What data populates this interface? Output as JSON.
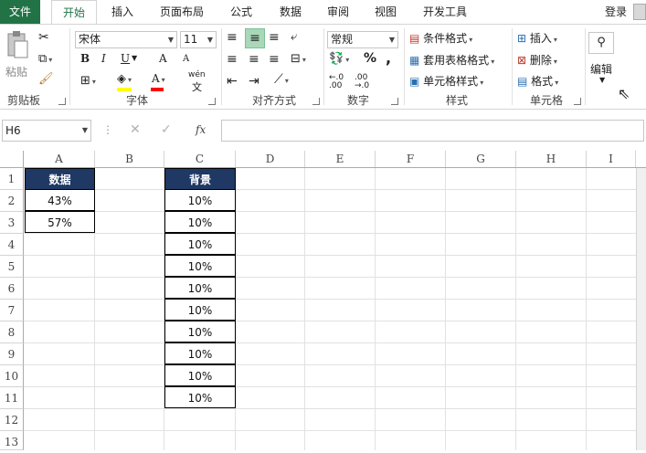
{
  "tabs": [
    "文件",
    "开始",
    "插入",
    "页面布局",
    "公式",
    "数据",
    "审阅",
    "视图",
    "开发工具"
  ],
  "login": "登录",
  "clipboard": {
    "paste": "粘贴",
    "group": "剪贴板"
  },
  "font": {
    "name": "宋体",
    "size": "11",
    "bold": "B",
    "italic": "I",
    "underline": "U",
    "grow": "A",
    "shrink": "A",
    "wen": "wén",
    "group": "字体"
  },
  "alignment": {
    "group": "对齐方式"
  },
  "number": {
    "format": "常规",
    "percent": "%",
    "comma": ",",
    "group": "数字"
  },
  "styles": {
    "conditional": "条件格式",
    "table": "套用表格格式",
    "cell": "单元格样式",
    "group": "样式"
  },
  "cells": {
    "insert": "插入",
    "delete": "删除",
    "format": "格式",
    "group": "单元格"
  },
  "editing": {
    "label": "编辑"
  },
  "formula_bar": {
    "name_box": "H6",
    "fx": "fx",
    "value": ""
  },
  "columns": [
    "A",
    "B",
    "C",
    "D",
    "E",
    "F",
    "G",
    "H",
    "I"
  ],
  "rows": [
    "1",
    "2",
    "3",
    "4",
    "5",
    "6",
    "7",
    "8",
    "9",
    "10",
    "11",
    "12",
    "13"
  ],
  "sheet": {
    "a_header": "数据",
    "a_values": [
      "43%",
      "57%"
    ],
    "c_header": "背景",
    "c_values": [
      "10%",
      "10%",
      "10%",
      "10%",
      "10%",
      "10%",
      "10%",
      "10%",
      "10%",
      "10%"
    ]
  },
  "colors": {
    "excel_green": "#217346",
    "header_navy": "#1f3864"
  }
}
